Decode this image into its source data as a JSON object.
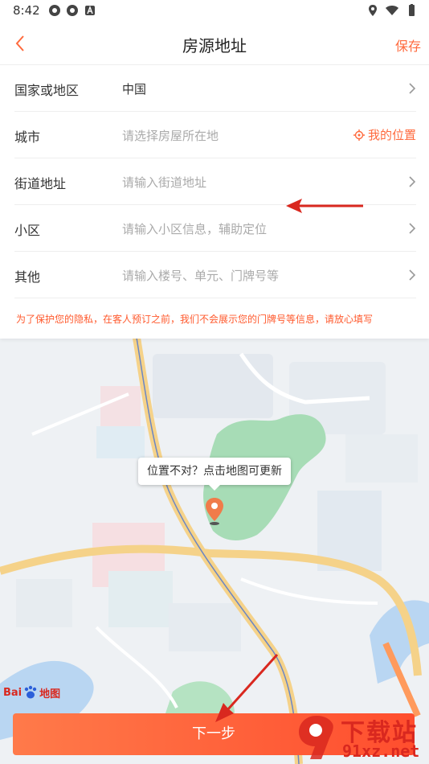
{
  "status_bar": {
    "time": "8:42"
  },
  "header": {
    "title": "房源地址",
    "save_label": "保存"
  },
  "form": {
    "rows": [
      {
        "label": "国家或地区",
        "value": "中国"
      },
      {
        "label": "城市",
        "placeholder": "请选择房屋所在地",
        "action": "我的位置"
      },
      {
        "label": "街道地址",
        "placeholder": "请输入街道地址"
      },
      {
        "label": "小区",
        "placeholder": "请输入小区信息，辅助定位"
      },
      {
        "label": "其他",
        "placeholder": "请输入楼号、单元、门牌号等"
      }
    ],
    "notice": "为了保护您的隐私，在客人预订之前，我们不会展示您的门牌号等信息，请放心填写"
  },
  "map": {
    "tooltip": "位置不对？点击地图可更新",
    "logo_left": "Bai",
    "logo_right": "地图"
  },
  "next_button": "下一步",
  "watermark": {
    "title": "下载站",
    "domain": "91xz.net"
  },
  "colors": {
    "accent": "#ff6a3d",
    "button_start": "#ff7a4a",
    "button_end": "#ff4e2e",
    "annotation_arrow": "#d9281f"
  }
}
